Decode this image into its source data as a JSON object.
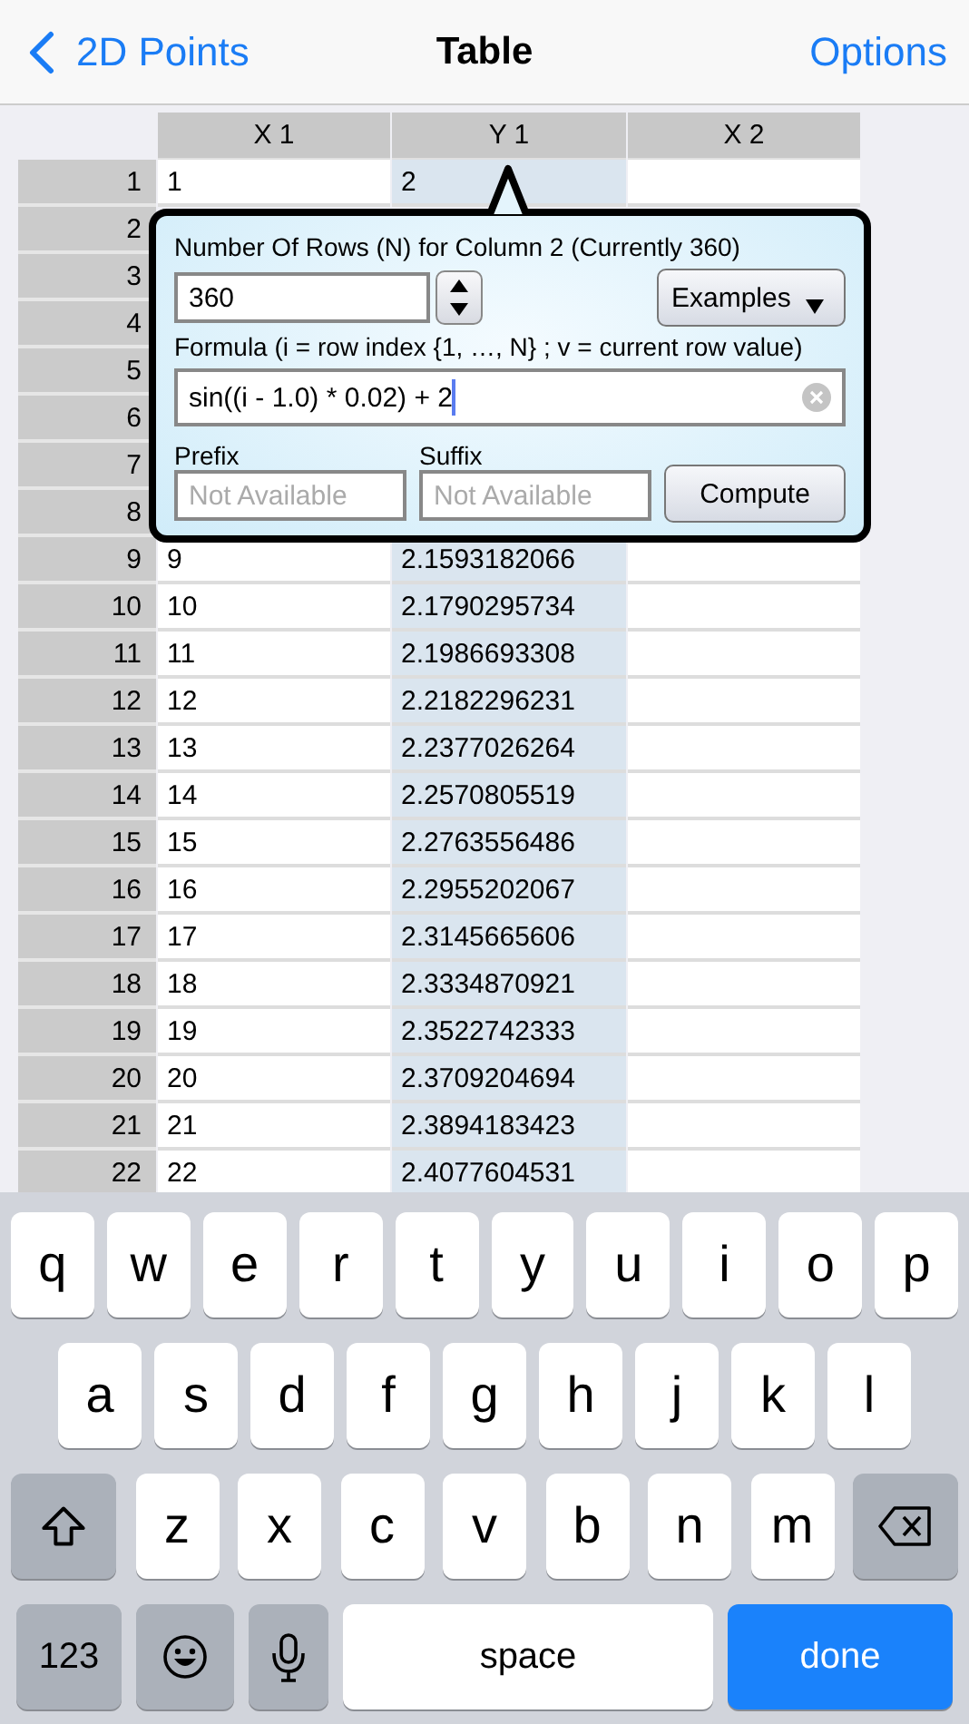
{
  "nav": {
    "back": "2D Points",
    "title": "Table",
    "action": "Options"
  },
  "table": {
    "columns": [
      {
        "label": "X 1",
        "selected": false
      },
      {
        "label": "Y 1",
        "selected": true
      },
      {
        "label": "X 2",
        "selected": false
      }
    ],
    "rows": [
      {
        "number": "1",
        "cells": [
          "1",
          "2"
        ]
      },
      {
        "number": "2"
      },
      {
        "number": "3"
      },
      {
        "number": "4"
      },
      {
        "number": "5"
      },
      {
        "number": "6"
      },
      {
        "number": "7"
      },
      {
        "number": "8"
      },
      {
        "number": "9",
        "cells": [
          "9",
          "2.1593182066"
        ]
      },
      {
        "number": "10",
        "cells": [
          "10",
          "2.1790295734"
        ]
      },
      {
        "number": "11",
        "cells": [
          "11",
          "2.1986693308"
        ]
      },
      {
        "number": "12",
        "cells": [
          "12",
          "2.2182296231"
        ]
      },
      {
        "number": "13",
        "cells": [
          "13",
          "2.2377026264"
        ]
      },
      {
        "number": "14",
        "cells": [
          "14",
          "2.2570805519"
        ]
      },
      {
        "number": "15",
        "cells": [
          "15",
          "2.2763556486"
        ]
      },
      {
        "number": "16",
        "cells": [
          "16",
          "2.2955202067"
        ]
      },
      {
        "number": "17",
        "cells": [
          "17",
          "2.3145665606"
        ]
      },
      {
        "number": "18",
        "cells": [
          "18",
          "2.3334870921"
        ]
      },
      {
        "number": "19",
        "cells": [
          "19",
          "2.3522742333"
        ]
      },
      {
        "number": "20",
        "cells": [
          "20",
          "2.3709204694"
        ]
      },
      {
        "number": "21",
        "cells": [
          "21",
          "2.3894183423"
        ]
      },
      {
        "number": "22",
        "cells": [
          "22",
          "2.4077604531"
        ]
      }
    ]
  },
  "popover": {
    "rows_label": "Number Of Rows (N) for Column 2 (Currently 360)",
    "rows_value": "360",
    "examples_button": "Examples",
    "formula_label": "Formula (i = row index {1, …, N} ; v = current row value)",
    "formula_value": "sin((i - 1.0) * 0.02) + 2",
    "prefix_label": "Prefix",
    "prefix_placeholder": "Not Available",
    "suffix_label": "Suffix",
    "suffix_placeholder": "Not Available",
    "compute_button": "Compute"
  },
  "keyboard": [
    [
      {
        "kind": "letter",
        "label": "q"
      },
      {
        "kind": "letter",
        "label": "w"
      },
      {
        "kind": "letter",
        "label": "e"
      },
      {
        "kind": "letter",
        "label": "r"
      },
      {
        "kind": "letter",
        "label": "t"
      },
      {
        "kind": "letter",
        "label": "y"
      },
      {
        "kind": "letter",
        "label": "u"
      },
      {
        "kind": "letter",
        "label": "i"
      },
      {
        "kind": "letter",
        "label": "o"
      },
      {
        "kind": "letter",
        "label": "p"
      }
    ],
    [
      {
        "kind": "letter",
        "label": "a"
      },
      {
        "kind": "letter",
        "label": "s"
      },
      {
        "kind": "letter",
        "label": "d"
      },
      {
        "kind": "letter",
        "label": "f"
      },
      {
        "kind": "letter",
        "label": "g"
      },
      {
        "kind": "letter",
        "label": "h"
      },
      {
        "kind": "letter",
        "label": "j"
      },
      {
        "kind": "letter",
        "label": "k"
      },
      {
        "kind": "letter",
        "label": "l"
      }
    ],
    [
      {
        "kind": "shift"
      },
      {
        "kind": "letter",
        "label": "z"
      },
      {
        "kind": "letter",
        "label": "x"
      },
      {
        "kind": "letter",
        "label": "c"
      },
      {
        "kind": "letter",
        "label": "v"
      },
      {
        "kind": "letter",
        "label": "b"
      },
      {
        "kind": "letter",
        "label": "n"
      },
      {
        "kind": "letter",
        "label": "m"
      },
      {
        "kind": "delete"
      }
    ],
    [
      {
        "kind": "numbers",
        "label": "123"
      },
      {
        "kind": "emoji"
      },
      {
        "kind": "mic"
      },
      {
        "kind": "space",
        "label": "space"
      },
      {
        "kind": "done",
        "label": "done"
      }
    ]
  ]
}
